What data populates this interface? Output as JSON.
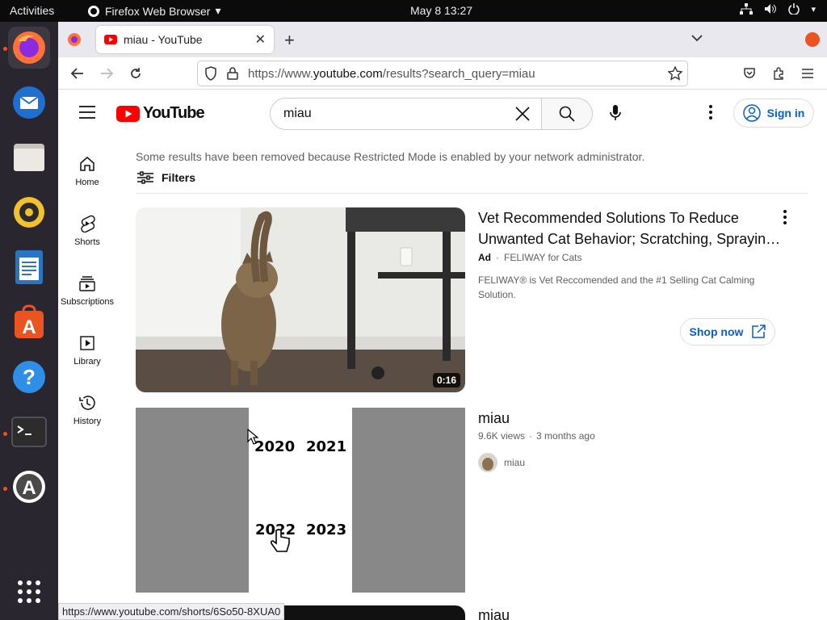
{
  "topbar": {
    "activities": "Activities",
    "app_name": "Firefox Web Browser",
    "clock": "May 8  13:27"
  },
  "dock": {
    "items": [
      "firefox-icon",
      "thunderbird-icon",
      "files-icon",
      "rhythmbox-icon",
      "writer-icon",
      "app-center-icon",
      "help-icon",
      "terminal-icon",
      "software-updater-icon",
      "app-grid-icon"
    ]
  },
  "browser": {
    "tab_title": "miau - YouTube",
    "url_prefix": "https://www.",
    "url_domain": "youtube.com",
    "url_path": "/results?search_query=miau",
    "status_url": "https://www.youtube.com/shorts/6So50-8XUA0"
  },
  "youtube": {
    "logo_text": "YouTube",
    "search_value": "miau",
    "sign_in": "Sign in",
    "nav": [
      {
        "label": "Home"
      },
      {
        "label": "Shorts"
      },
      {
        "label": "Subscriptions"
      },
      {
        "label": "Library"
      },
      {
        "label": "History"
      }
    ],
    "notice": "Some results have been removed because Restricted Mode is enabled by your network administrator.",
    "filters": "Filters",
    "results": [
      {
        "title": "Vet Recommended Solutions To Reduce Unwanted Cat Behavior; Scratching, Sprayin…",
        "ad_badge": "Ad",
        "channel": "FELIWAY for Cats",
        "description": "FELIWAY® is Vet Reccomended and the #1 Selling Cat Calming Solution.",
        "duration": "0:16",
        "cta": "Shop now"
      },
      {
        "title": "miau",
        "views": "9.6K views",
        "age": "3 months ago",
        "channel": "miau",
        "years": [
          "2020",
          "2021",
          "2022",
          "2023"
        ]
      },
      {
        "title": "miau"
      }
    ]
  },
  "colors": {
    "yt_red": "#ff0000",
    "link_blue": "#065fd4",
    "ubuntu_orange": "#e95420"
  }
}
